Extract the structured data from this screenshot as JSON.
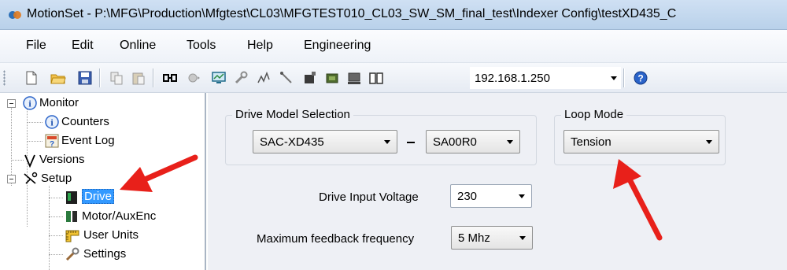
{
  "window": {
    "title": "MotionSet - P:\\MFG\\Production\\Mfgtest\\CL03\\MFGTEST010_CL03_SW_SM_final_test\\Indexer Config\\testXD435_C"
  },
  "menu": {
    "items": [
      "File",
      "Edit",
      "Online",
      "Tools",
      "Help",
      "Engineering"
    ]
  },
  "toolbar": {
    "ip_address": "192.168.1.250",
    "icons": [
      "new-file-icon",
      "open-folder-icon",
      "save-icon",
      "copy-icon",
      "paste-icon",
      "connect-icon",
      "disconnect-icon",
      "monitor-icon",
      "wrench-icon",
      "wave-icon",
      "probe-icon",
      "flag-icon",
      "chip-icon",
      "drive-icon",
      "book-icon",
      "help-icon"
    ]
  },
  "tree": {
    "monitor": "Monitor",
    "counters": "Counters",
    "event_log": "Event Log",
    "versions": "Versions",
    "setup": "Setup",
    "drive": "Drive",
    "motor_auxenc": "Motor/AuxEnc",
    "user_units": "User Units",
    "settings": "Settings"
  },
  "drive_model": {
    "group_title": "Drive Model Selection",
    "model": "SAC-XD435",
    "separator": "–",
    "variant": "SA00R0"
  },
  "loop_mode": {
    "group_title": "Loop Mode",
    "value": "Tension"
  },
  "drive_input_voltage": {
    "label": "Drive Input Voltage",
    "value": "230"
  },
  "max_feedback_frequency": {
    "label": "Maximum feedback frequency",
    "value": "5 Mhz"
  },
  "colors": {
    "selection": "#3399ff",
    "annotation_arrow": "#e8201a",
    "panel_background": "#eef0f5"
  }
}
